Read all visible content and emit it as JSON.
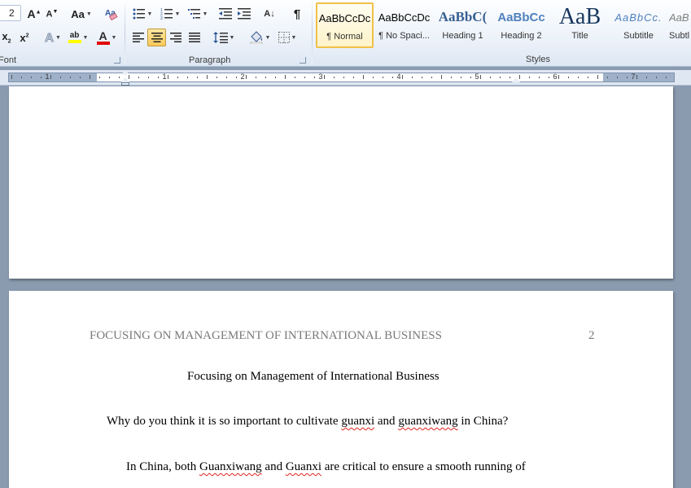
{
  "ribbon": {
    "font_group": {
      "label": "Font",
      "size_value": "2",
      "grow_font": "A",
      "shrink_font": "A",
      "change_case": "Aa",
      "subscript": "x",
      "superscript": "x",
      "text_effects": "A",
      "highlight": "ab",
      "font_color": "A"
    },
    "paragraph_group": {
      "label": "Paragraph",
      "show_formatting": "¶",
      "sort": "A↓"
    },
    "styles_group": {
      "label": "Styles",
      "styles": [
        {
          "preview": "AaBbCcDc",
          "name": "¶ Normal",
          "selected": true
        },
        {
          "preview": "AaBbCcDc",
          "name": "¶ No Spaci...",
          "selected": false
        },
        {
          "preview": "AaBbC(",
          "name": "Heading 1",
          "selected": false
        },
        {
          "preview": "AaBbCc",
          "name": "Heading 2",
          "selected": false
        },
        {
          "preview": "AaB",
          "name": "Title",
          "selected": false
        },
        {
          "preview": "AaBbCc.",
          "name": "Subtitle",
          "selected": false
        },
        {
          "preview": "AaB",
          "name": "Subtl",
          "selected": false
        }
      ]
    }
  },
  "ruler": {
    "numbers": [
      "1",
      "1",
      "2",
      "3",
      "4",
      "5",
      "6",
      "7"
    ]
  },
  "document": {
    "page2": {
      "running_head": "FOCUSING ON MANAGEMENT OF INTERNATIONAL BUSINESS",
      "page_number": "2",
      "title": "Focusing on Management of International Business",
      "question": {
        "t1": "Why do you think it is so important to cultivate ",
        "w1": "guanxi",
        "t2": " and ",
        "w2": "guanxiwang",
        "t3": " in China?"
      },
      "para": {
        "t1": "In China, both ",
        "w1": "Guanxiwang",
        "t2": " and ",
        "w2": "Guanxi",
        "t3": " are critical to ensure a smooth running of"
      }
    }
  },
  "colors": {
    "highlight": "#ffff00",
    "font_color": "#e00000",
    "heading": "#2b5797"
  }
}
